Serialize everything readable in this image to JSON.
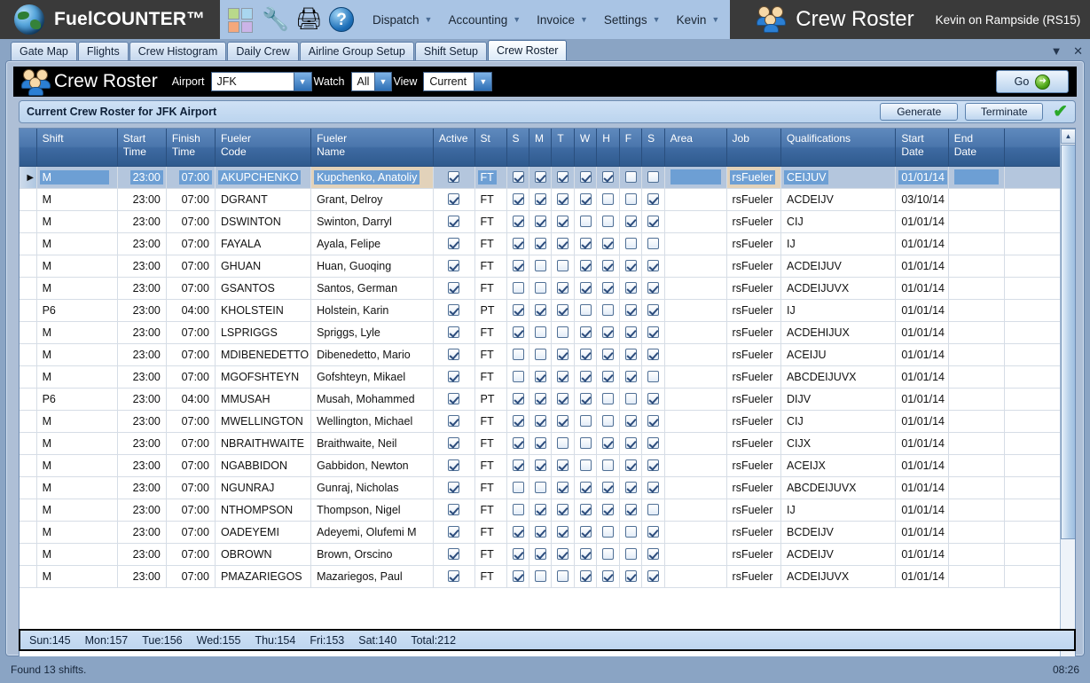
{
  "header": {
    "brand": "FuelCOUNTER™",
    "icons": [
      "squares-icon",
      "drill-icon",
      "printer-icon",
      "help-icon"
    ],
    "menus": [
      {
        "label": "Dispatch"
      },
      {
        "label": "Accounting"
      },
      {
        "label": "Invoice"
      },
      {
        "label": "Settings"
      },
      {
        "label": "Kevin"
      }
    ],
    "title": "Crew Roster",
    "user": "Kevin on Rampside (RS15)"
  },
  "tabs": [
    {
      "label": "Gate Map",
      "active": false
    },
    {
      "label": "Flights",
      "active": false
    },
    {
      "label": "Crew Histogram",
      "active": false
    },
    {
      "label": "Daily Crew",
      "active": false
    },
    {
      "label": "Airline Group Setup",
      "active": false
    },
    {
      "label": "Shift Setup",
      "active": false
    },
    {
      "label": "Crew Roster",
      "active": true
    }
  ],
  "window_controls": {
    "minimize": "▼",
    "close": "✕"
  },
  "querybar": {
    "title": "Crew Roster",
    "airport_label": "Airport",
    "airport_value": "JFK",
    "watch_label": "Watch",
    "watch_value": "All",
    "view_label": "View",
    "view_value": "Current",
    "go_label": "Go"
  },
  "caption": {
    "text": "Current Crew Roster for JFK Airport",
    "generate_label": "Generate",
    "terminate_label": "Terminate",
    "ok_icon": "✔"
  },
  "grid": {
    "columns": [
      "Shift",
      "Start\nTime",
      "Finish\nTime",
      "Fueler\nCode",
      "Fueler\nName",
      "Active",
      "St",
      "S",
      "M",
      "T",
      "W",
      "H",
      "F",
      "S",
      "Area",
      "Job",
      "Qualifications",
      "Start\nDate",
      "End\nDate",
      ""
    ],
    "rows": [
      {
        "selected": true,
        "shift": "M",
        "start": "23:00",
        "finish": "07:00",
        "code": "AKUPCHENKO",
        "name": "Kupchenko, Anatoliy",
        "active": true,
        "st": "FT",
        "days": [
          1,
          1,
          1,
          1,
          1,
          0,
          0
        ],
        "area": "",
        "job": "rsFueler",
        "qual": "CEIJUV",
        "start_date": "01/01/14",
        "end_date": ""
      },
      {
        "selected": false,
        "shift": "M",
        "start": "23:00",
        "finish": "07:00",
        "code": "DGRANT",
        "name": "Grant, Delroy",
        "active": true,
        "st": "FT",
        "days": [
          1,
          1,
          1,
          1,
          0,
          0,
          1
        ],
        "area": "",
        "job": "rsFueler",
        "qual": "ACDEIJV",
        "start_date": "03/10/14",
        "end_date": ""
      },
      {
        "selected": false,
        "shift": "M",
        "start": "23:00",
        "finish": "07:00",
        "code": "DSWINTON",
        "name": "Swinton, Darryl",
        "active": true,
        "st": "FT",
        "days": [
          1,
          1,
          1,
          0,
          0,
          1,
          1
        ],
        "area": "",
        "job": "rsFueler",
        "qual": "CIJ",
        "start_date": "01/01/14",
        "end_date": ""
      },
      {
        "selected": false,
        "shift": "M",
        "start": "23:00",
        "finish": "07:00",
        "code": "FAYALA",
        "name": "Ayala, Felipe",
        "active": true,
        "st": "FT",
        "days": [
          1,
          1,
          1,
          1,
          1,
          0,
          0
        ],
        "area": "",
        "job": "rsFueler",
        "qual": "IJ",
        "start_date": "01/01/14",
        "end_date": ""
      },
      {
        "selected": false,
        "shift": "M",
        "start": "23:00",
        "finish": "07:00",
        "code": "GHUAN",
        "name": "Huan, Guoqing",
        "active": true,
        "st": "FT",
        "days": [
          1,
          0,
          0,
          1,
          1,
          1,
          1
        ],
        "area": "",
        "job": "rsFueler",
        "qual": "ACDEIJUV",
        "start_date": "01/01/14",
        "end_date": ""
      },
      {
        "selected": false,
        "shift": "M",
        "start": "23:00",
        "finish": "07:00",
        "code": "GSANTOS",
        "name": "Santos, German",
        "active": true,
        "st": "FT",
        "days": [
          0,
          0,
          1,
          1,
          1,
          1,
          1
        ],
        "area": "",
        "job": "rsFueler",
        "qual": "ACDEIJUVX",
        "start_date": "01/01/14",
        "end_date": ""
      },
      {
        "selected": false,
        "shift": "P6",
        "start": "23:00",
        "finish": "04:00",
        "code": "KHOLSTEIN",
        "name": "Holstein, Karin",
        "active": true,
        "st": "PT",
        "days": [
          1,
          1,
          1,
          0,
          0,
          1,
          1
        ],
        "area": "",
        "job": "rsFueler",
        "qual": "IJ",
        "start_date": "01/01/14",
        "end_date": ""
      },
      {
        "selected": false,
        "shift": "M",
        "start": "23:00",
        "finish": "07:00",
        "code": "LSPRIGGS",
        "name": "Spriggs, Lyle",
        "active": true,
        "st": "FT",
        "days": [
          1,
          0,
          0,
          1,
          1,
          1,
          1
        ],
        "area": "",
        "job": "rsFueler",
        "qual": "ACDEHIJUX",
        "start_date": "01/01/14",
        "end_date": ""
      },
      {
        "selected": false,
        "shift": "M",
        "start": "23:00",
        "finish": "07:00",
        "code": "MDIBENEDETTO",
        "name": "Dibenedetto, Mario",
        "active": true,
        "st": "FT",
        "days": [
          0,
          0,
          1,
          1,
          1,
          1,
          1
        ],
        "area": "",
        "job": "rsFueler",
        "qual": "ACEIJU",
        "start_date": "01/01/14",
        "end_date": ""
      },
      {
        "selected": false,
        "shift": "M",
        "start": "23:00",
        "finish": "07:00",
        "code": "MGOFSHTEYN",
        "name": "Gofshteyn, Mikael",
        "active": true,
        "st": "FT",
        "days": [
          0,
          1,
          1,
          1,
          1,
          1,
          0
        ],
        "area": "",
        "job": "rsFueler",
        "qual": "ABCDEIJUVX",
        "start_date": "01/01/14",
        "end_date": ""
      },
      {
        "selected": false,
        "shift": "P6",
        "start": "23:00",
        "finish": "04:00",
        "code": "MMUSAH",
        "name": "Musah, Mohammed",
        "active": true,
        "st": "PT",
        "days": [
          1,
          1,
          1,
          1,
          0,
          0,
          1
        ],
        "area": "",
        "job": "rsFueler",
        "qual": "DIJV",
        "start_date": "01/01/14",
        "end_date": ""
      },
      {
        "selected": false,
        "shift": "M",
        "start": "23:00",
        "finish": "07:00",
        "code": "MWELLINGTON",
        "name": "Wellington, Michael",
        "active": true,
        "st": "FT",
        "days": [
          1,
          1,
          1,
          0,
          0,
          1,
          1
        ],
        "area": "",
        "job": "rsFueler",
        "qual": "CIJ",
        "start_date": "01/01/14",
        "end_date": ""
      },
      {
        "selected": false,
        "shift": "M",
        "start": "23:00",
        "finish": "07:00",
        "code": "NBRAITHWAITE",
        "name": "Braithwaite, Neil",
        "active": true,
        "st": "FT",
        "days": [
          1,
          1,
          0,
          0,
          1,
          1,
          1
        ],
        "area": "",
        "job": "rsFueler",
        "qual": "CIJX",
        "start_date": "01/01/14",
        "end_date": ""
      },
      {
        "selected": false,
        "shift": "M",
        "start": "23:00",
        "finish": "07:00",
        "code": "NGABBIDON",
        "name": "Gabbidon, Newton",
        "active": true,
        "st": "FT",
        "days": [
          1,
          1,
          1,
          0,
          0,
          1,
          1
        ],
        "area": "",
        "job": "rsFueler",
        "qual": "ACEIJX",
        "start_date": "01/01/14",
        "end_date": ""
      },
      {
        "selected": false,
        "shift": "M",
        "start": "23:00",
        "finish": "07:00",
        "code": "NGUNRAJ",
        "name": "Gunraj, Nicholas",
        "active": true,
        "st": "FT",
        "days": [
          0,
          0,
          1,
          1,
          1,
          1,
          1
        ],
        "area": "",
        "job": "rsFueler",
        "qual": "ABCDEIJUVX",
        "start_date": "01/01/14",
        "end_date": ""
      },
      {
        "selected": false,
        "shift": "M",
        "start": "23:00",
        "finish": "07:00",
        "code": "NTHOMPSON",
        "name": "Thompson, Nigel",
        "active": true,
        "st": "FT",
        "days": [
          0,
          1,
          1,
          1,
          1,
          1,
          0
        ],
        "area": "",
        "job": "rsFueler",
        "qual": "IJ",
        "start_date": "01/01/14",
        "end_date": ""
      },
      {
        "selected": false,
        "shift": "M",
        "start": "23:00",
        "finish": "07:00",
        "code": "OADEYEMI",
        "name": "Adeyemi, Olufemi M",
        "active": true,
        "st": "FT",
        "days": [
          1,
          1,
          1,
          1,
          0,
          0,
          1
        ],
        "area": "",
        "job": "rsFueler",
        "qual": "BCDEIJV",
        "start_date": "01/01/14",
        "end_date": ""
      },
      {
        "selected": false,
        "shift": "M",
        "start": "23:00",
        "finish": "07:00",
        "code": "OBROWN",
        "name": "Brown, Orscino",
        "active": true,
        "st": "FT",
        "days": [
          1,
          1,
          1,
          1,
          0,
          0,
          1
        ],
        "area": "",
        "job": "rsFueler",
        "qual": "ACDEIJV",
        "start_date": "01/01/14",
        "end_date": ""
      },
      {
        "selected": false,
        "shift": "M",
        "start": "23:00",
        "finish": "07:00",
        "code": "PMAZARIEGOS",
        "name": "Mazariegos, Paul",
        "active": true,
        "st": "FT",
        "days": [
          1,
          0,
          0,
          1,
          1,
          1,
          1
        ],
        "area": "",
        "job": "rsFueler",
        "qual": "ACDEIJUVX",
        "start_date": "01/01/14",
        "end_date": ""
      }
    ]
  },
  "totals": [
    "Sun:145",
    "Mon:157",
    "Tue:156",
    "Wed:155",
    "Thu:154",
    "Fri:153",
    "Sat:140",
    "Total:212"
  ],
  "statusbar": {
    "message": "Found 13 shifts.",
    "time": "08:26"
  },
  "colors": {
    "accent": "#2f5a8e",
    "name_cell": "#e2d2ba",
    "selection": "#6d9fd4",
    "ok_green": "#2aa828"
  }
}
